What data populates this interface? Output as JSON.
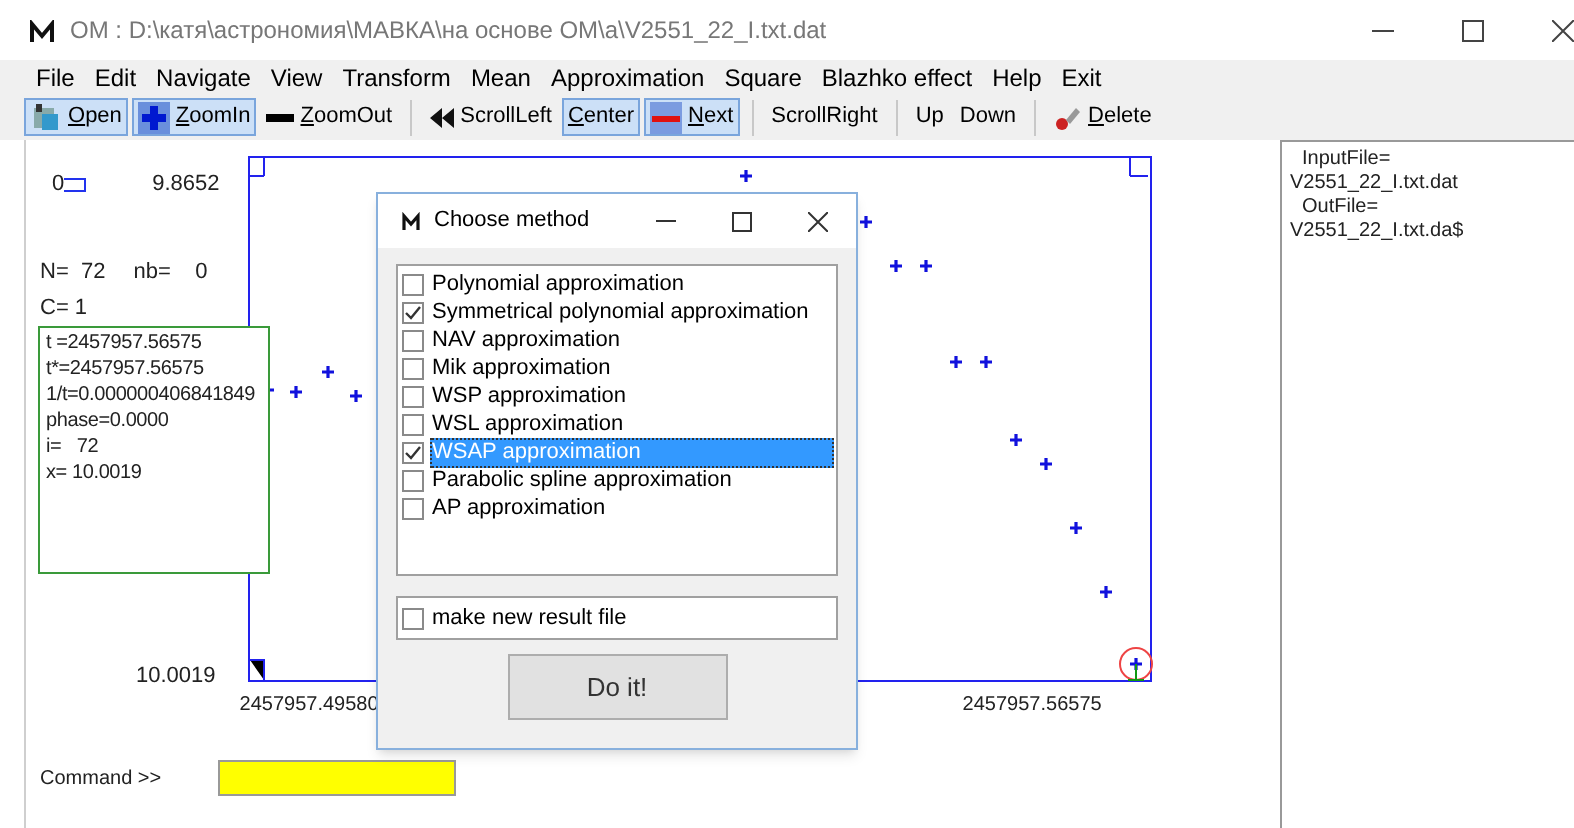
{
  "window": {
    "title": "OM : D:\\катя\\астрономия\\МАВКА\\на основе ОМ\\а\\V2551_22_I.txt.dat"
  },
  "menu": [
    "File",
    "Edit",
    "Navigate",
    "View",
    "Transform",
    "Mean",
    "Approximation",
    "Square",
    "Blazhko effect",
    "Help",
    "Exit"
  ],
  "toolbar": [
    [
      {
        "label": "Open",
        "pressed": true,
        "mnemonic": true
      },
      {
        "label": "ZoomIn",
        "pressed": true,
        "mnemonic": true
      },
      {
        "label": "ZoomOut",
        "pressed": false,
        "mnemonic": true
      }
    ],
    [
      {
        "label": "ScrollLeft",
        "pressed": false,
        "mnemonic": false
      },
      {
        "label": "Center",
        "pressed": true,
        "mnemonic": true
      },
      {
        "label": "Next",
        "pressed": true,
        "mnemonic": true
      }
    ],
    [
      {
        "label": "ScrollRight",
        "pressed": false,
        "mnemonic": false
      }
    ],
    [
      {
        "label": "Up",
        "pressed": false,
        "mnemonic": false
      },
      {
        "label": "Down",
        "pressed": false,
        "mnemonic": false
      }
    ],
    [
      {
        "label": "Delete",
        "pressed": false,
        "mnemonic": true
      }
    ]
  ],
  "info": {
    "zero": "0",
    "y_max": "9.8652",
    "n": "N=  72",
    "nb": "nb=    0",
    "c": "C= 1",
    "point_lines": [
      "t =2457957.56575",
      "t*=2457957.56575",
      "1/t=0.000000406841849",
      "phase=0.0000",
      "i=   72",
      "x= 10.0019"
    ],
    "y_min": "10.0019",
    "x_min": "2457957.49580",
    "x_max": "2457957.56575"
  },
  "files": [
    "InputFile=",
    "V2551_22_I.txt.dat",
    "OutFile=",
    "V2551_22_I.txt.da$"
  ],
  "command": {
    "label": "Command >>"
  },
  "dialog": {
    "title": "Choose method",
    "methods": [
      {
        "label": "Polynomial approximation",
        "checked": false,
        "selected": false
      },
      {
        "label": "Symmetrical polynomial approximation",
        "checked": true,
        "selected": false
      },
      {
        "label": "NAV approximation",
        "checked": false,
        "selected": false
      },
      {
        "label": "Mik approximation",
        "checked": false,
        "selected": false
      },
      {
        "label": "WSP approximation",
        "checked": false,
        "selected": false
      },
      {
        "label": "WSL approximation",
        "checked": false,
        "selected": false
      },
      {
        "label": "WSAP approximation",
        "checked": true,
        "selected": true
      },
      {
        "label": "Parabolic spline approximation",
        "checked": false,
        "selected": false
      },
      {
        "label": "AP approximation",
        "checked": false,
        "selected": false
      }
    ],
    "option": {
      "label": "make new result file",
      "checked": false
    },
    "button": "Do it!"
  }
}
